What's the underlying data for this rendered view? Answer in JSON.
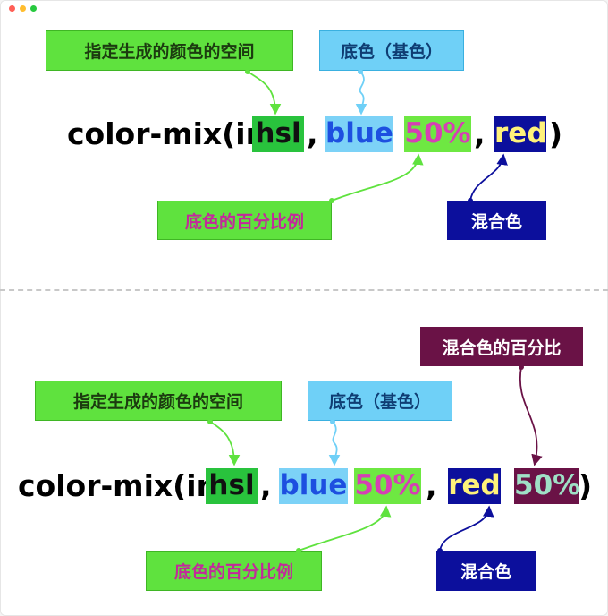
{
  "colors": {
    "green": "#5fe23e",
    "light_blue": "#6fd0f7",
    "navy": "#0c0f9c",
    "maroon": "#6a1246",
    "magenta": "#d63fb4",
    "mint": "#9fe0c6",
    "yellow": "#fff27a",
    "hsl_green": "#29c33d"
  },
  "top": {
    "label_space": "指定生成的颜色的空间",
    "label_base": "底色（基色）",
    "label_percent": "底色的百分比例",
    "label_mix": "混合色",
    "code": {
      "prefix": "color-mix(in",
      "space": "hsl",
      "comma1": ",",
      "base": "blue",
      "percent": "50%",
      "comma2": ",",
      "mix": "red",
      "close": ")"
    }
  },
  "bottom": {
    "label_space": "指定生成的颜色的空间",
    "label_base": "底色（基色）",
    "label_percent": "底色的百分比例",
    "label_mix": "混合色",
    "label_mix_percent": "混合色的百分比",
    "code": {
      "prefix": "color-mix(in",
      "space": "hsl",
      "comma1": ",",
      "base": "blue",
      "percent": "50%",
      "comma2": ",",
      "mix": "red",
      "mix_percent": "50%",
      "close": ")"
    }
  }
}
